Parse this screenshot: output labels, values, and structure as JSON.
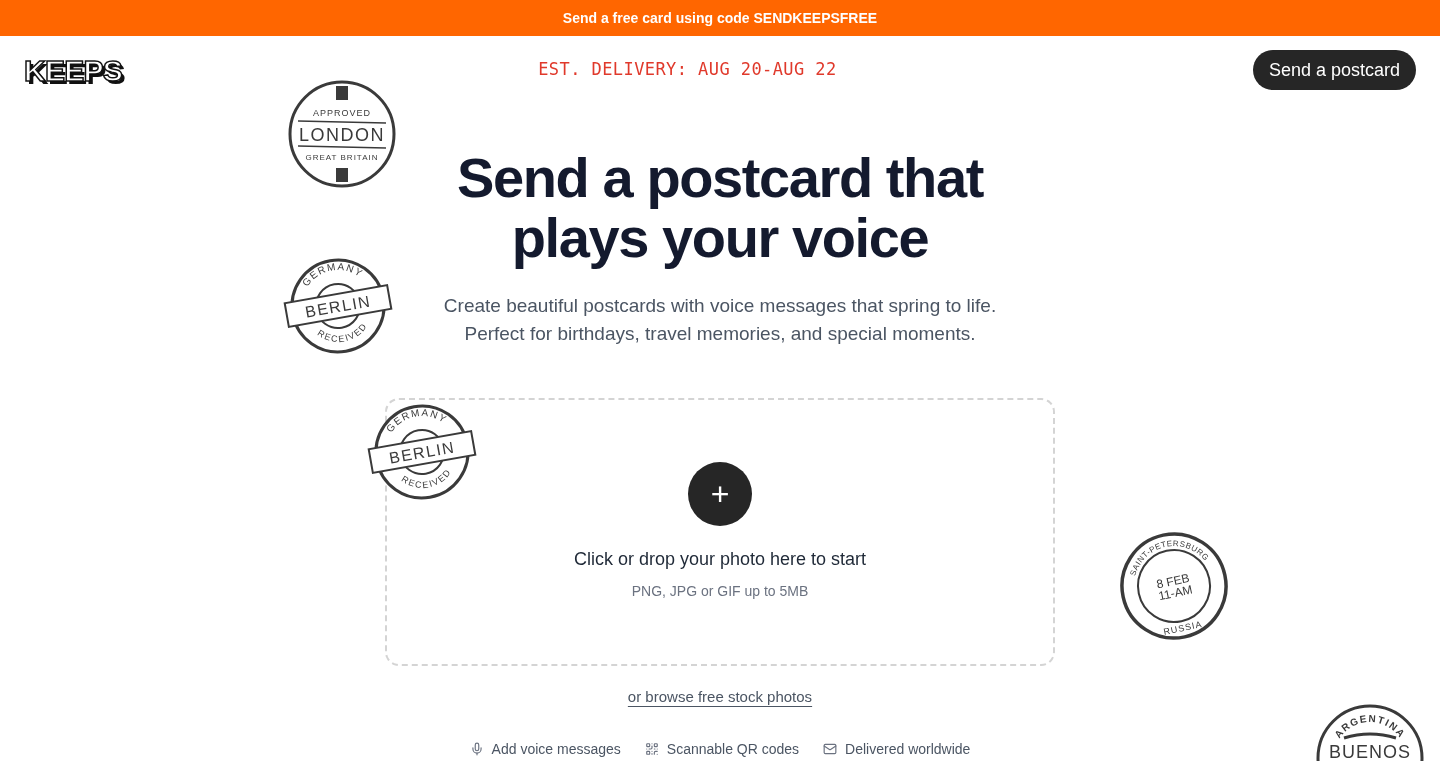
{
  "promo_bar": {
    "text": "Send a free card using code **SENDKEEPSFREE**"
  },
  "header": {
    "logo": "KEEPS",
    "delivery_estimate": "EST. DELIVERY: AUG 20-AUG 22",
    "cta_button": "Send a postcard"
  },
  "hero": {
    "title_lines": [
      "Send a postcard that",
      "plays your voice"
    ],
    "subtitle_lines": [
      "Create beautiful postcards with voice messages that spring to life.",
      "Perfect for birthdays, travel memories, and special moments."
    ]
  },
  "upload": {
    "button": "+",
    "title": "Click or drop your photo here to start",
    "hint": "PNG, JPG or GIF up to 5MB"
  },
  "stock_link": "or browse free stock photos",
  "features": [
    {
      "kind": "voice",
      "label": "Add voice messages"
    },
    {
      "kind": "qr",
      "label": "Scannable QR codes"
    },
    {
      "kind": "mail",
      "label": "Delivered worldwide"
    }
  ],
  "stamps": [
    {
      "kind": "banner",
      "top": "APPROVED",
      "main": "LONDON",
      "bottom": "GREAT BRITAIN"
    },
    {
      "kind": "ribbon",
      "top": "GERMANY",
      "main": "BERLIN",
      "bottom": "RECEIVED"
    },
    {
      "kind": "ribbon",
      "top": "GERMANY",
      "main": "BERLIN",
      "bottom": "RECEIVED"
    },
    {
      "kind": "dated",
      "top": "SAINT-PETERSBURG",
      "main": "8 FEB",
      "sub": "11-AM",
      "bottom": "RUSSIA"
    },
    {
      "kind": "city",
      "top": "ARGENTINA",
      "main": "BUENOS"
    }
  ]
}
